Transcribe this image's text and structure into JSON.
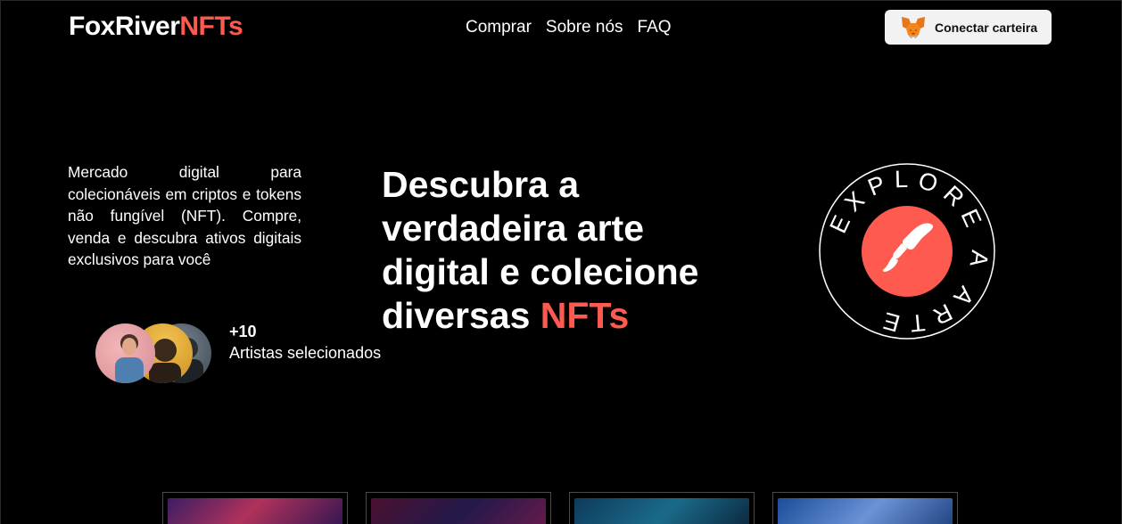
{
  "brand": {
    "name_main": "FoxRiver",
    "name_accent": "NFTs",
    "accent_color": "#ff5a4f"
  },
  "nav": {
    "items": [
      {
        "label": "Comprar"
      },
      {
        "label": "Sobre nós"
      },
      {
        "label": "FAQ"
      }
    ]
  },
  "wallet": {
    "label": "Conectar carteira",
    "icon": "metamask-fox-icon"
  },
  "hero": {
    "description": "Mercado digital para colecionáveis em criptos e tokens não fungível (NFT). Compre, venda e descubra ativos digitais exclusivos para você",
    "headline_main": "Descubra a verdadeira arte digital e colecione diversas ",
    "headline_accent": "NFTs",
    "artists_count": "+10",
    "artists_label": "Artistas selecionados"
  },
  "badge": {
    "ring_text": "EXPLORE A ARTE",
    "icon": "paint-brush-icon",
    "accent_color": "#ff5a4f"
  },
  "gallery": {
    "cards": 4
  }
}
